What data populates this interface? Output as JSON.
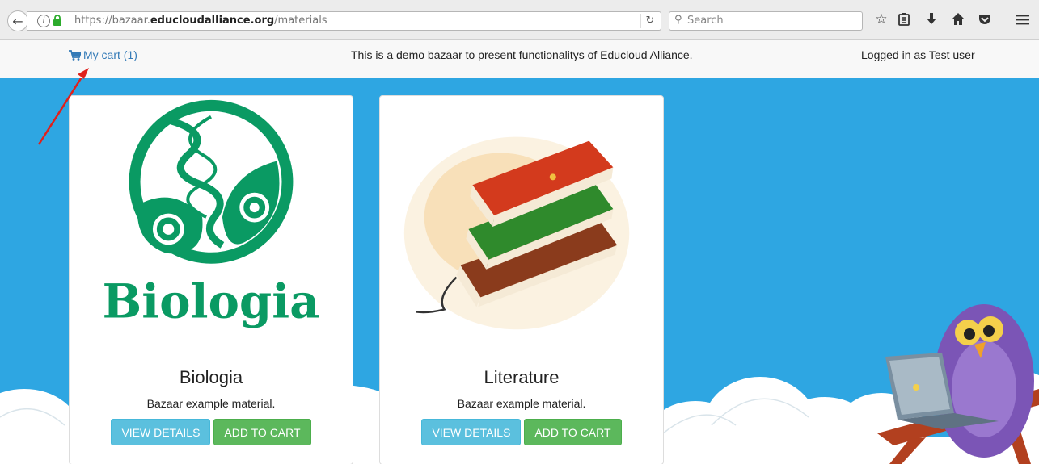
{
  "browser": {
    "url_prefix": "https://bazaar.",
    "url_domain": "educloudalliance.org",
    "url_path": "/materials",
    "search_placeholder": "Search"
  },
  "navbar": {
    "cart_label": "My cart (1)",
    "demo_message": "This is a demo bazaar to present functionalitys of Educloud Alliance.",
    "logged_in": "Logged in as Test user"
  },
  "materials": [
    {
      "title": "Biologia",
      "logo_text": "Biologia",
      "description": "Bazaar example material.",
      "view_label": "VIEW DETAILS",
      "cart_label": "ADD TO CART"
    },
    {
      "title": "Literature",
      "description": "Bazaar example material.",
      "view_label": "VIEW DETAILS",
      "cart_label": "ADD TO CART"
    }
  ],
  "colors": {
    "background": "#2ea6e2",
    "link": "#337ab7",
    "btn_info": "#5bc0de",
    "btn_success": "#5cb85c",
    "biology_green": "#0a9a63",
    "annotation_arrow": "#e0201b"
  },
  "icons": [
    "back-arrow-icon",
    "info-icon",
    "lock-icon",
    "reload-icon",
    "search-icon",
    "bookmark-star-icon",
    "reading-list-icon",
    "download-icon",
    "home-icon",
    "pocket-icon",
    "menu-icon",
    "cart-icon"
  ]
}
